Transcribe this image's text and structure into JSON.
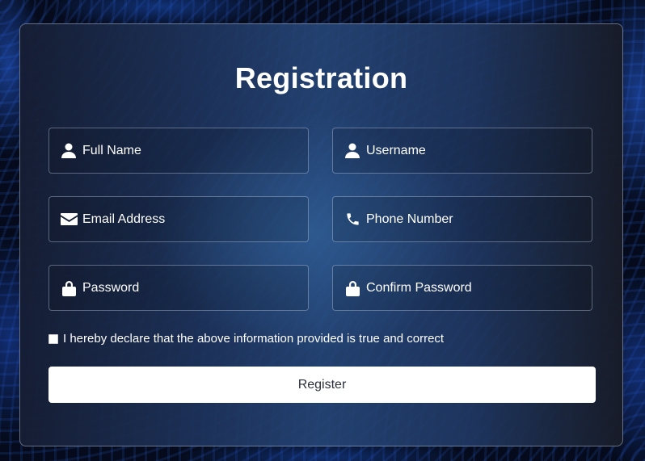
{
  "title": "Registration",
  "fields": [
    {
      "name": "full-name",
      "placeholder": "Full Name",
      "icon": "user-icon"
    },
    {
      "name": "username",
      "placeholder": "Username",
      "icon": "user-icon"
    },
    {
      "name": "email",
      "placeholder": "Email Address",
      "icon": "envelope-icon"
    },
    {
      "name": "phone",
      "placeholder": "Phone Number",
      "icon": "phone-icon"
    },
    {
      "name": "password",
      "placeholder": "Password",
      "icon": "lock-icon"
    },
    {
      "name": "confirm-password",
      "placeholder": "Confirm Password",
      "icon": "lock-icon"
    }
  ],
  "declaration": {
    "label": "I hereby declare that the above information provided is true and correct",
    "checked": false
  },
  "register_button": {
    "label": "Register"
  },
  "colors": {
    "card_border": "#c8d2e6",
    "text": "#ffffff",
    "button_bg": "#ffffff",
    "button_text": "#2b2f3a"
  }
}
